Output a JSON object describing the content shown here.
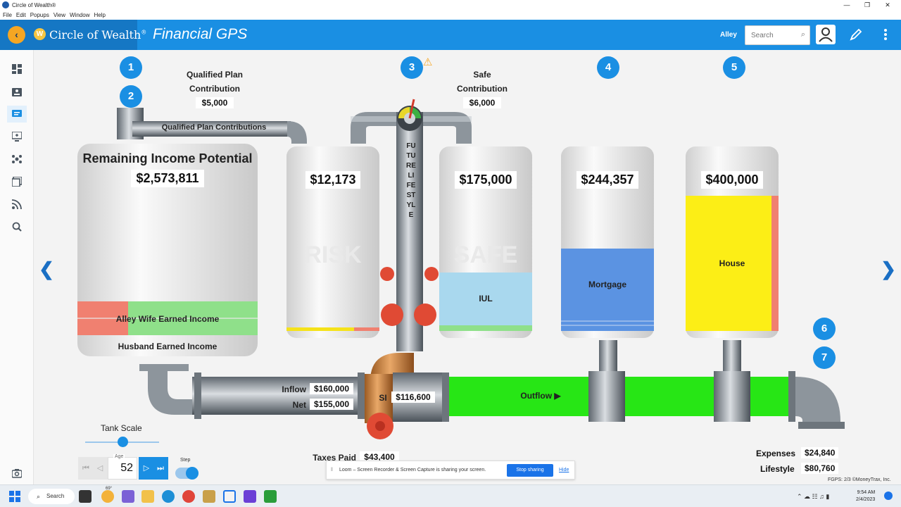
{
  "window": {
    "title": "Circle of Wealth®",
    "controls": [
      "—",
      "❐",
      "✕"
    ]
  },
  "menu": [
    "File",
    "Edit",
    "Popups",
    "View",
    "Window",
    "Help"
  ],
  "header": {
    "back_icon": "chevron-left-icon",
    "logo_letter": "W",
    "logo_text": "Circle of Wealth",
    "logo_reg": "®",
    "title": "Financial GPS",
    "user": "Alley",
    "search_placeholder": "Search",
    "search_icon": "search-icon",
    "profile_icon": "user-icon",
    "edit_icon": "pencil-icon",
    "more_icon": "kebab-icon"
  },
  "sidebar": {
    "items": [
      {
        "icon": "dashboard-icon",
        "active": false
      },
      {
        "icon": "contact-card-icon",
        "active": false
      },
      {
        "icon": "chat-icon",
        "active": true
      },
      {
        "icon": "monitor-icon",
        "active": false
      },
      {
        "icon": "network-icon",
        "active": false
      },
      {
        "icon": "library-icon",
        "active": false
      },
      {
        "icon": "rss-icon",
        "active": false
      },
      {
        "icon": "zoom-search-icon",
        "active": false
      }
    ],
    "bottom_icon": "camera-icon"
  },
  "steps": [
    "1",
    "2",
    "3",
    "4",
    "5",
    "6",
    "7"
  ],
  "warning_icon": "warning-icon",
  "qualified": {
    "title_line1": "Qualified Plan",
    "title_line2": "Contribution",
    "value": "$5,000",
    "pipe_label": "Qualified Plan Contributions"
  },
  "safe_contribution": {
    "title_line1": "Safe",
    "title_line2": "Contribution",
    "value": "$6,000"
  },
  "future_lifestyle_label": "FUTURE LIFESTYLE",
  "tanks": {
    "income": {
      "title": "Remaining Income Potential",
      "value": "$2,573,811",
      "rows": [
        "Alley Wife Earned Income",
        "Husband Earned Income"
      ]
    },
    "risk": {
      "value": "$12,173",
      "watermark": "RISK"
    },
    "safe": {
      "value": "$175,000",
      "watermark": "SAFE",
      "fill_label": "IUL"
    },
    "mortgage": {
      "value": "$244,357",
      "fill_label": "Mortgage"
    },
    "house": {
      "value": "$400,000",
      "fill_label": "House"
    }
  },
  "flows": {
    "inflow_label": "Inflow",
    "inflow_value": "$160,000",
    "net_label": "Net",
    "net_value": "$155,000",
    "si_label": "SI",
    "si_value": "$116,600",
    "outflow_label": "Outflow ▶",
    "taxes_label": "Taxes Paid",
    "taxes_value": "$43,400"
  },
  "nav": {
    "left": "❮",
    "right": "❯"
  },
  "controls": {
    "tank_scale_label": "Tank Scale",
    "age_label": "Age",
    "age_value": "52",
    "step_label": "Step",
    "first_icon": "skip-first-icon",
    "prev_icon": "play-back-icon",
    "next_icon": "play-icon",
    "last_icon": "skip-last-icon"
  },
  "loom": {
    "message": "Loom – Screen Recorder & Screen Capture is sharing your screen.",
    "stop": "Stop sharing",
    "hide": "Hide"
  },
  "summary": {
    "expenses_label": "Expenses",
    "expenses_value": "$24,840",
    "lifestyle_label": "Lifestyle",
    "lifestyle_value": "$80,760"
  },
  "footer": "FGPS: 2/3 ©MoneyTrax, Inc.",
  "taskbar": {
    "search": "Search",
    "temp": "69°",
    "time": "9:54 AM",
    "date": "2/4/2023"
  }
}
